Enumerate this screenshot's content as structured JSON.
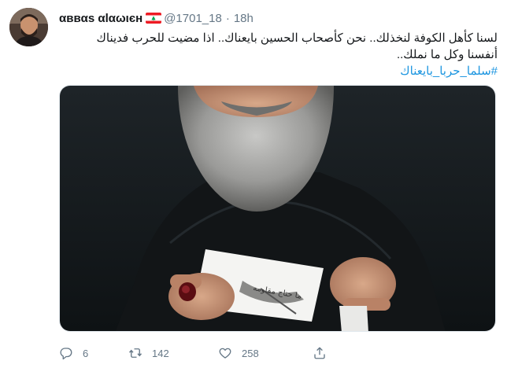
{
  "tweet": {
    "author_name": "αввαs αlαωιєн",
    "flag_icon": "lebanon-flag-icon",
    "handle": "@1701_18",
    "separator": "·",
    "time": "18h",
    "text_line1": "لسنا كأهل الكوفة لنخذلك.. نحن كأصحاب الحسين بايعناك.. اذا مضيت للحرب فديناك",
    "text_line2": "أنفسنا وكل ما نملك..",
    "hashtag": "#سلما_حربا_بايعناك",
    "media_caption": "ما حتاج مقاومه"
  },
  "actions": {
    "reply_count": "6",
    "retweet_count": "142",
    "like_count": "258"
  },
  "icons": [
    "reply-icon",
    "retweet-icon",
    "like-icon",
    "share-icon"
  ],
  "colors": {
    "text": "#14171a",
    "secondary": "#657786",
    "link": "#1b95e0",
    "border": "#e1e8ed"
  }
}
